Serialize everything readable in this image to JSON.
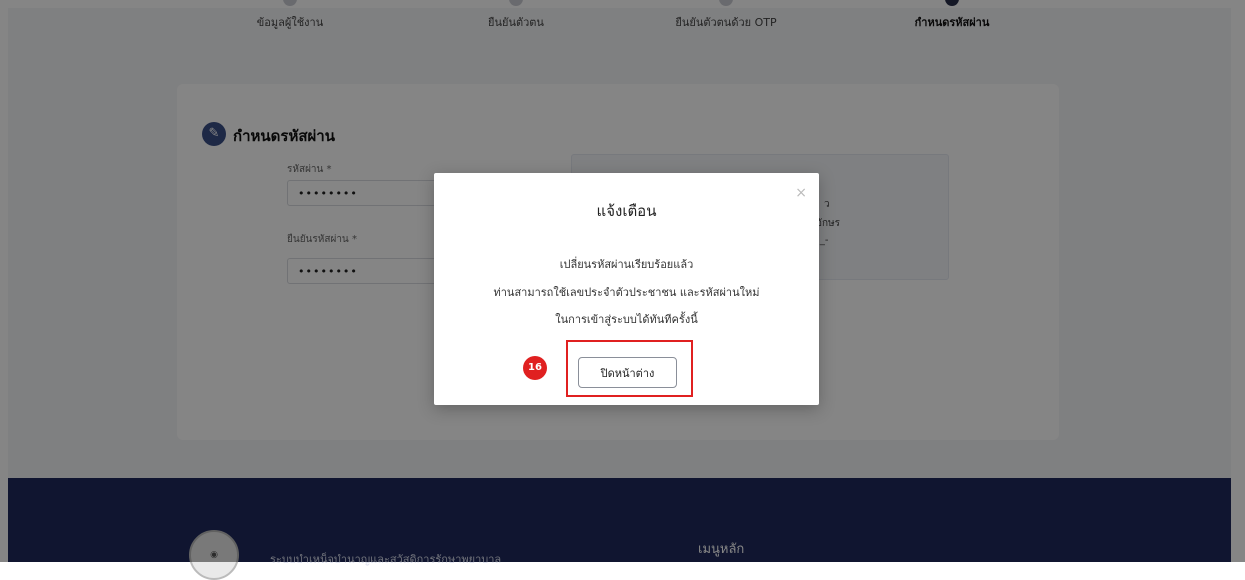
{
  "stepper": {
    "steps": [
      {
        "label": "ข้อมูลผู้ใช้งาน",
        "active": false
      },
      {
        "label": "ยืนยันตัวตน",
        "active": false
      },
      {
        "label": "ยืนยันตัวตนด้วย OTP",
        "active": false
      },
      {
        "label": "กำหนดรหัสผ่าน",
        "active": true
      }
    ]
  },
  "card": {
    "title": "กำหนดรหัสผ่าน",
    "password_label": "รหัสผ่าน *",
    "password_value": "••••••••",
    "confirm_label": "ยืนยันรหัสผ่าน *",
    "confirm_value": "••••••••",
    "hint_lines": [
      "ว",
      "อักษร",
      "(_-"
    ]
  },
  "modal": {
    "title": "แจ้งเตือน",
    "close_icon": "×",
    "lines": [
      "เปลี่ยนรหัสผ่านเรียบร้อยแล้ว",
      "ท่านสามารถใช้เลขประจำตัวประชาชน และรหัสผ่านใหม่",
      "ในการเข้าสู่ระบบได้ทันทีครั้งนี้"
    ],
    "button_label": "ปิดหน้าต่าง",
    "step_badge": "16"
  },
  "footer": {
    "site_name": "ระบบบำเหน็จบำนาญและสวัสดิการรักษาพยาบาล",
    "menu_heading": "เมนูหลัก"
  },
  "colors": {
    "overlay": "#000000",
    "footer": "#1f2a5c",
    "highlight": "#e02020",
    "accent": "#3b4f86"
  }
}
